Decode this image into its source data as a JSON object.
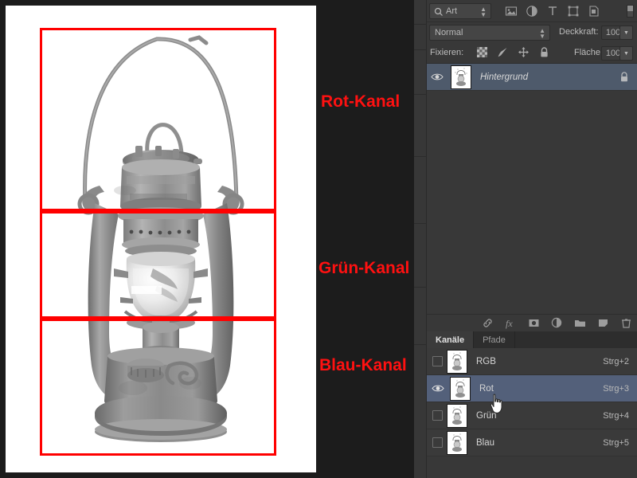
{
  "document": {
    "image_description": "grayscale photo of an old kerosene hurricane lantern on white background"
  },
  "annotations": {
    "color": "#ff0000",
    "regions": [
      {
        "label": "Rot-Kanal",
        "name": "red-channel-region"
      },
      {
        "label": "Grün-Kanal",
        "name": "green-channel-region"
      },
      {
        "label": "Blau-Kanal",
        "name": "blue-channel-region"
      }
    ]
  },
  "layers_panel": {
    "filter": {
      "kind_label": "Art",
      "icons": [
        "pixel-layer-icon",
        "adjustment-layer-icon",
        "type-layer-icon",
        "shape-layer-icon",
        "smart-object-icon"
      ]
    },
    "blend_mode": "Normal",
    "opacity_label": "Deckkraft:",
    "opacity_value": "100%",
    "lock_label": "Fixieren:",
    "lock_icons": [
      "transparency-lock-icon",
      "image-lock-icon",
      "position-lock-icon",
      "all-lock-icon"
    ],
    "fill_label": "Fläche:",
    "fill_value": "100%",
    "layers": [
      {
        "name": "Hintergrund",
        "visible": true,
        "locked": true,
        "selected": true
      }
    ],
    "bottom_icons": [
      "link-layers-icon",
      "layer-style-fx-icon",
      "add-mask-icon",
      "adjustment-layer-icon",
      "new-group-icon",
      "new-layer-icon",
      "delete-layer-icon"
    ]
  },
  "channels_panel": {
    "tabs": [
      {
        "label": "Kanäle",
        "active": true
      },
      {
        "label": "Pfade",
        "active": false
      }
    ],
    "channels": [
      {
        "name": "RGB",
        "shortcut": "Strg+2",
        "visible": false,
        "selected": false
      },
      {
        "name": "Rot",
        "shortcut": "Strg+3",
        "visible": true,
        "selected": true
      },
      {
        "name": "Grün",
        "shortcut": "Strg+4",
        "visible": false,
        "selected": false
      },
      {
        "name": "Blau",
        "shortcut": "Strg+5",
        "visible": false,
        "selected": false
      }
    ]
  },
  "cursor": {
    "type": "pointing-hand-cursor"
  }
}
